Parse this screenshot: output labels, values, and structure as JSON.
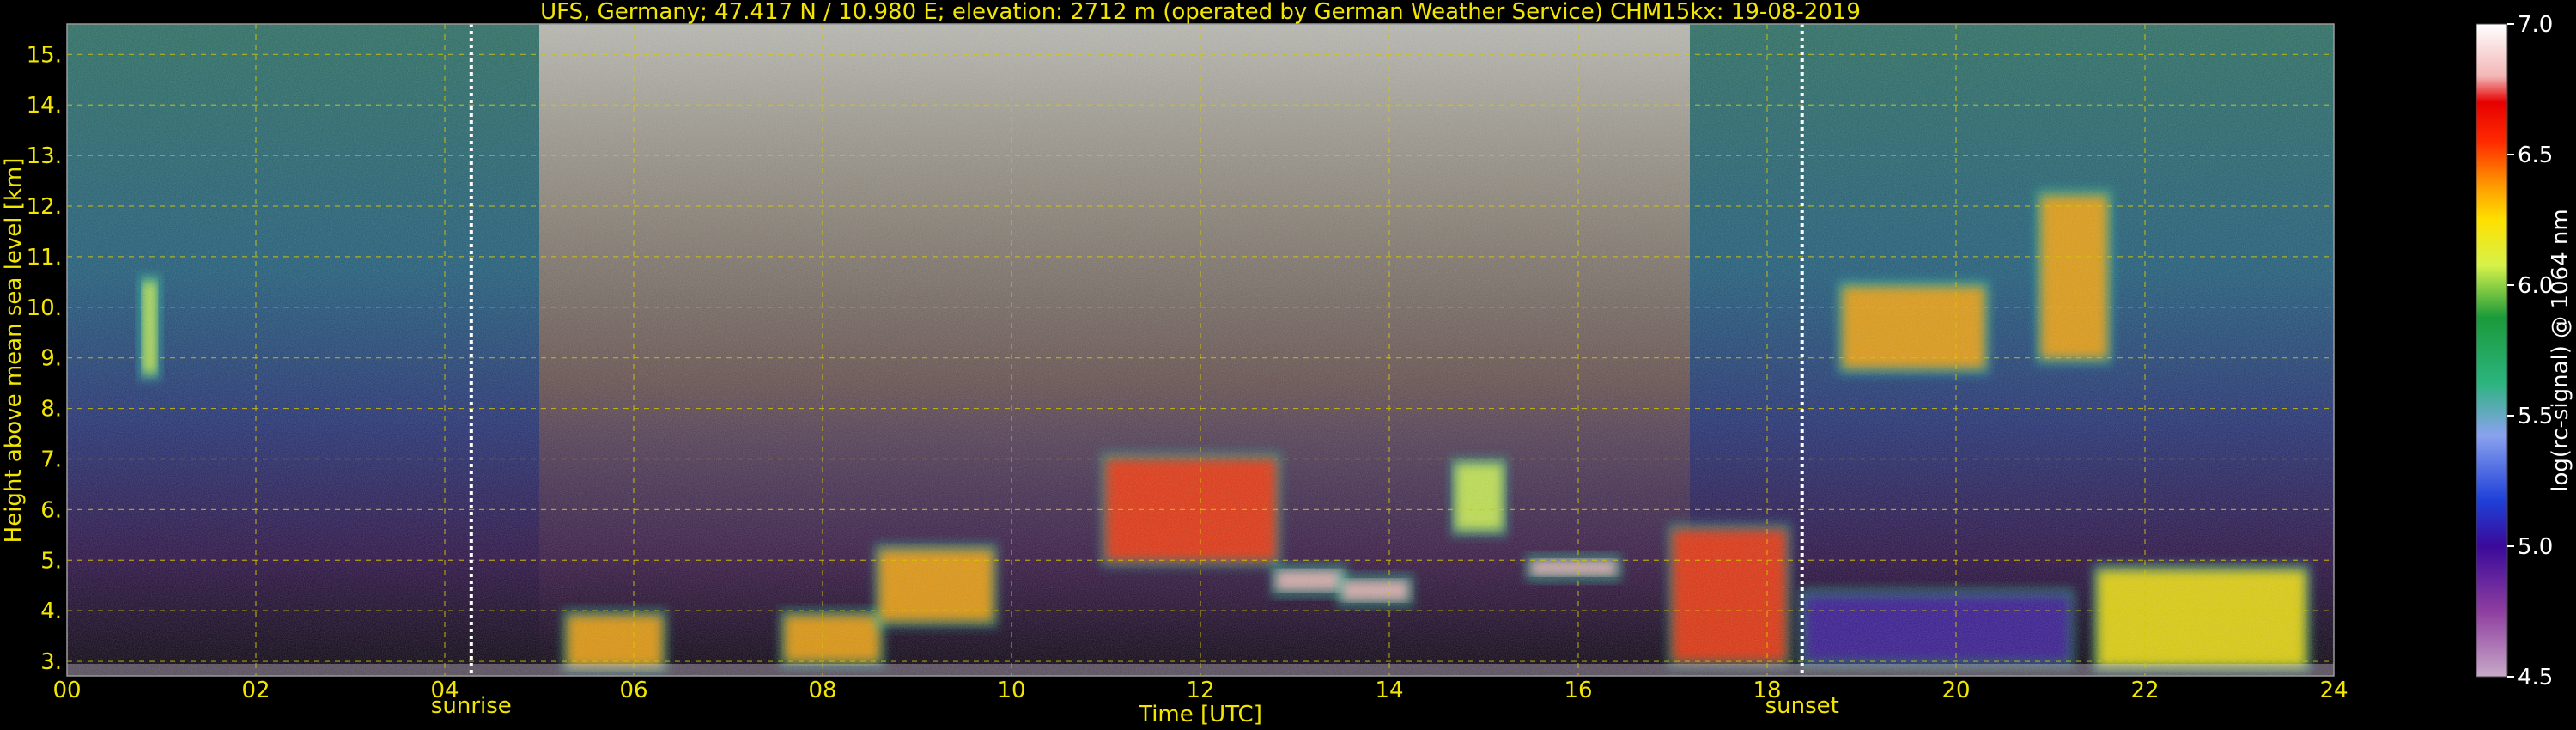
{
  "chart_data": {
    "type": "heatmap",
    "title": "UFS, Germany; 47.417 N / 10.980 E; elevation: 2712 m  (operated by German Weather Service)    CHM15kx: 19-08-2019",
    "xlabel": "Time [UTC]",
    "ylabel": "Height above mean sea level [km]",
    "xlim": [
      0,
      24
    ],
    "ylim": [
      2.712,
      15.6
    ],
    "x_ticks": [
      "00",
      "02",
      "04",
      "06",
      "08",
      "10",
      "12",
      "14",
      "16",
      "18",
      "20",
      "22",
      "24"
    ],
    "y_ticks": [
      "3.",
      "4.",
      "5.",
      "6.",
      "7.",
      "8.",
      "9.",
      "10.",
      "11.",
      "12.",
      "13.",
      "14.",
      "15."
    ],
    "grid": true,
    "events": [
      {
        "label": "sunrise",
        "time": 4.28
      },
      {
        "label": "sunset",
        "time": 18.37
      }
    ],
    "colorbar": {
      "label": "log(rc-signal) @ 1064 nm",
      "range": [
        4.5,
        7.0
      ],
      "ticks": [
        "4.5",
        "5.0",
        "5.5",
        "6.0",
        "6.5",
        "7.0"
      ]
    },
    "layers": [
      {
        "t0": 5.3,
        "t1": 6.3,
        "h0": 2.9,
        "h1": 3.9,
        "v": 6.4
      },
      {
        "t0": 7.6,
        "t1": 8.6,
        "h0": 3.0,
        "h1": 3.9,
        "v": 6.5
      },
      {
        "t0": 8.6,
        "t1": 9.8,
        "h0": 3.8,
        "h1": 5.2,
        "v": 6.5
      },
      {
        "t0": 11.0,
        "t1": 12.8,
        "h0": 5.0,
        "h1": 7.0,
        "v": 6.6
      },
      {
        "t0": 12.8,
        "t1": 13.5,
        "h0": 4.4,
        "h1": 4.8,
        "v": 6.8
      },
      {
        "t0": 13.5,
        "t1": 14.2,
        "h0": 4.2,
        "h1": 4.6,
        "v": 6.8
      },
      {
        "t0": 14.7,
        "t1": 15.2,
        "h0": 5.6,
        "h1": 6.9,
        "v": 6.2
      },
      {
        "t0": 15.5,
        "t1": 16.4,
        "h0": 4.7,
        "h1": 5.0,
        "v": 6.9
      },
      {
        "t0": 17.0,
        "t1": 18.2,
        "h0": 3.0,
        "h1": 5.6,
        "v": 6.6
      },
      {
        "t0": 18.4,
        "t1": 21.2,
        "h0": 3.0,
        "h1": 4.3,
        "v": 5.0
      },
      {
        "t0": 18.8,
        "t1": 20.3,
        "h0": 8.8,
        "h1": 10.4,
        "v": 6.4
      },
      {
        "t0": 20.9,
        "t1": 21.6,
        "h0": 9.0,
        "h1": 12.2,
        "v": 6.5
      },
      {
        "t0": 21.5,
        "t1": 23.7,
        "h0": 2.9,
        "h1": 4.8,
        "v": 6.3
      },
      {
        "t0": 0.8,
        "t1": 0.95,
        "h0": 8.7,
        "h1": 10.5,
        "v": 6.2
      }
    ]
  }
}
